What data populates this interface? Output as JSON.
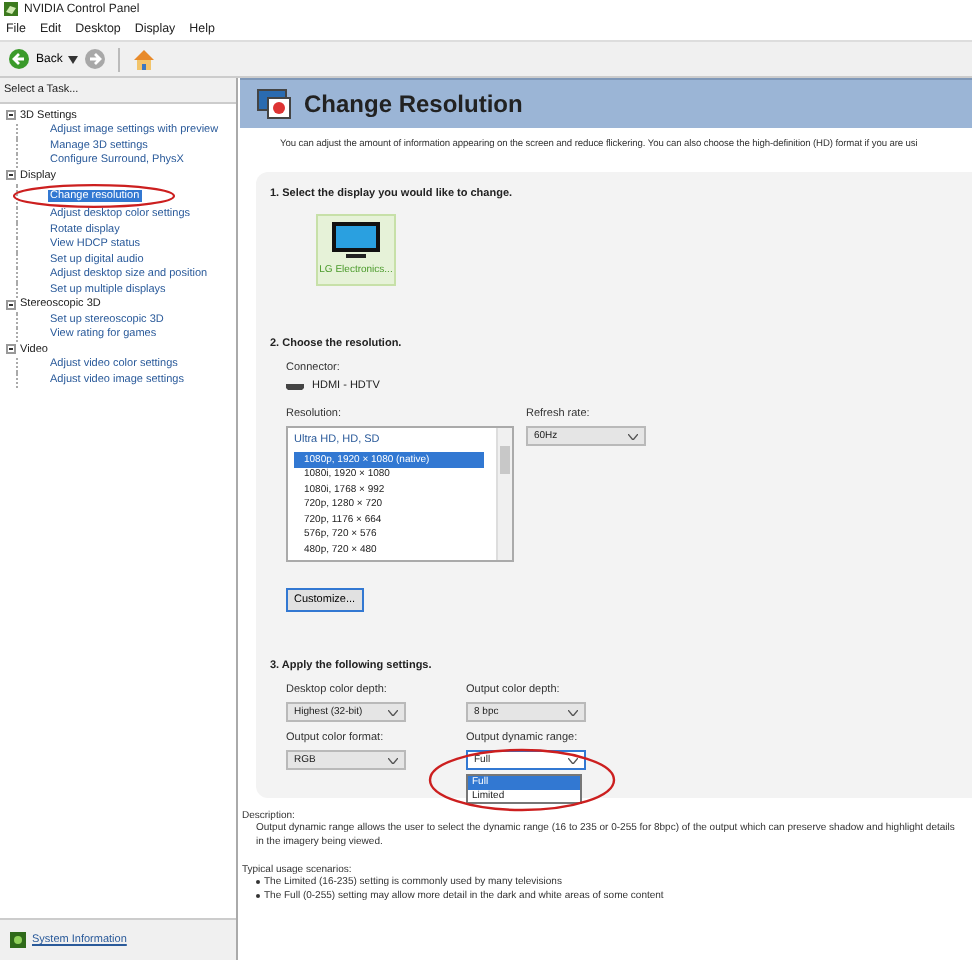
{
  "window": {
    "title": "NVIDIA Control Panel"
  },
  "menu": [
    "File",
    "Edit",
    "Desktop",
    "Display",
    "Help"
  ],
  "toolbar": {
    "back": "Back"
  },
  "sidebar": {
    "heading": "Select a Task...",
    "tree": [
      {
        "label": "3D Settings",
        "expanded": true,
        "children": [
          {
            "label": "Adjust image settings with preview",
            "selected": false
          },
          {
            "label": "Manage 3D settings",
            "selected": false
          },
          {
            "label": "Configure Surround, PhysX",
            "selected": false
          }
        ]
      },
      {
        "label": "Display",
        "expanded": true,
        "children": [
          {
            "label": "Change resolution",
            "selected": true
          },
          {
            "label": "Adjust desktop color settings",
            "selected": false
          },
          {
            "label": "Rotate display",
            "selected": false
          },
          {
            "label": "View HDCP status",
            "selected": false
          },
          {
            "label": "Set up digital audio",
            "selected": false
          },
          {
            "label": "Adjust desktop size and position",
            "selected": false
          },
          {
            "label": "Set up multiple displays",
            "selected": false
          }
        ]
      },
      {
        "label": "Stereoscopic 3D",
        "expanded": true,
        "children": [
          {
            "label": "Set up stereoscopic 3D",
            "selected": false
          },
          {
            "label": "View rating for games",
            "selected": false
          }
        ]
      },
      {
        "label": "Video",
        "expanded": true,
        "children": [
          {
            "label": "Adjust video color settings",
            "selected": false
          },
          {
            "label": "Adjust video image settings",
            "selected": false
          }
        ]
      }
    ],
    "footer_link": "System Information"
  },
  "page": {
    "title": "Change Resolution",
    "intro": "You can adjust the amount of information appearing on the screen and reduce flickering. You can also choose the high-definition (HD) format if you are usi",
    "step1": {
      "heading": "1. Select the display you would like to change.",
      "displays": [
        {
          "label": "LG Electronics...",
          "selected": true
        }
      ]
    },
    "step2": {
      "heading": "2. Choose the resolution.",
      "connector_label": "Connector:",
      "connector": "HDMI - HDTV",
      "resolution_label": "Resolution:",
      "resolution_group": "Ultra HD, HD, SD",
      "resolutions": [
        {
          "label": "1080p, 1920 × 1080 (native)",
          "selected": true
        },
        {
          "label": "1080i, 1920 × 1080",
          "selected": false
        },
        {
          "label": "1080i, 1768 × 992",
          "selected": false
        },
        {
          "label": "720p, 1280 × 720",
          "selected": false
        },
        {
          "label": "720p, 1176 × 664",
          "selected": false
        },
        {
          "label": "576p, 720 × 576",
          "selected": false
        },
        {
          "label": "480p, 720 × 480",
          "selected": false
        }
      ],
      "refresh_label": "Refresh rate:",
      "refresh": "60Hz",
      "customize": "Customize..."
    },
    "step3": {
      "heading": "3. Apply the following settings.",
      "fields": [
        {
          "label": "Desktop color depth:",
          "value": "Highest (32-bit)"
        },
        {
          "label": "Output color depth:",
          "value": "8 bpc"
        },
        {
          "label": "Output color format:",
          "value": "RGB"
        },
        {
          "label": "Output dynamic range:",
          "value": "Full",
          "options": [
            {
              "label": "Full",
              "selected": true
            },
            {
              "label": "Limited",
              "selected": false
            }
          ]
        }
      ]
    },
    "description_label": "Description:",
    "description": "Output dynamic range allows the user to select the dynamic range (16 to 235 or 0-255 for 8bpc) of the output which can preserve shadow and highlight details in the imagery being viewed.",
    "usage_label": "Typical usage scenarios:",
    "usage": [
      "The Limited (16-235) setting is commonly used by many televisions",
      "The Full (0-255) setting may allow more detail in the dark and white areas of some content"
    ]
  }
}
